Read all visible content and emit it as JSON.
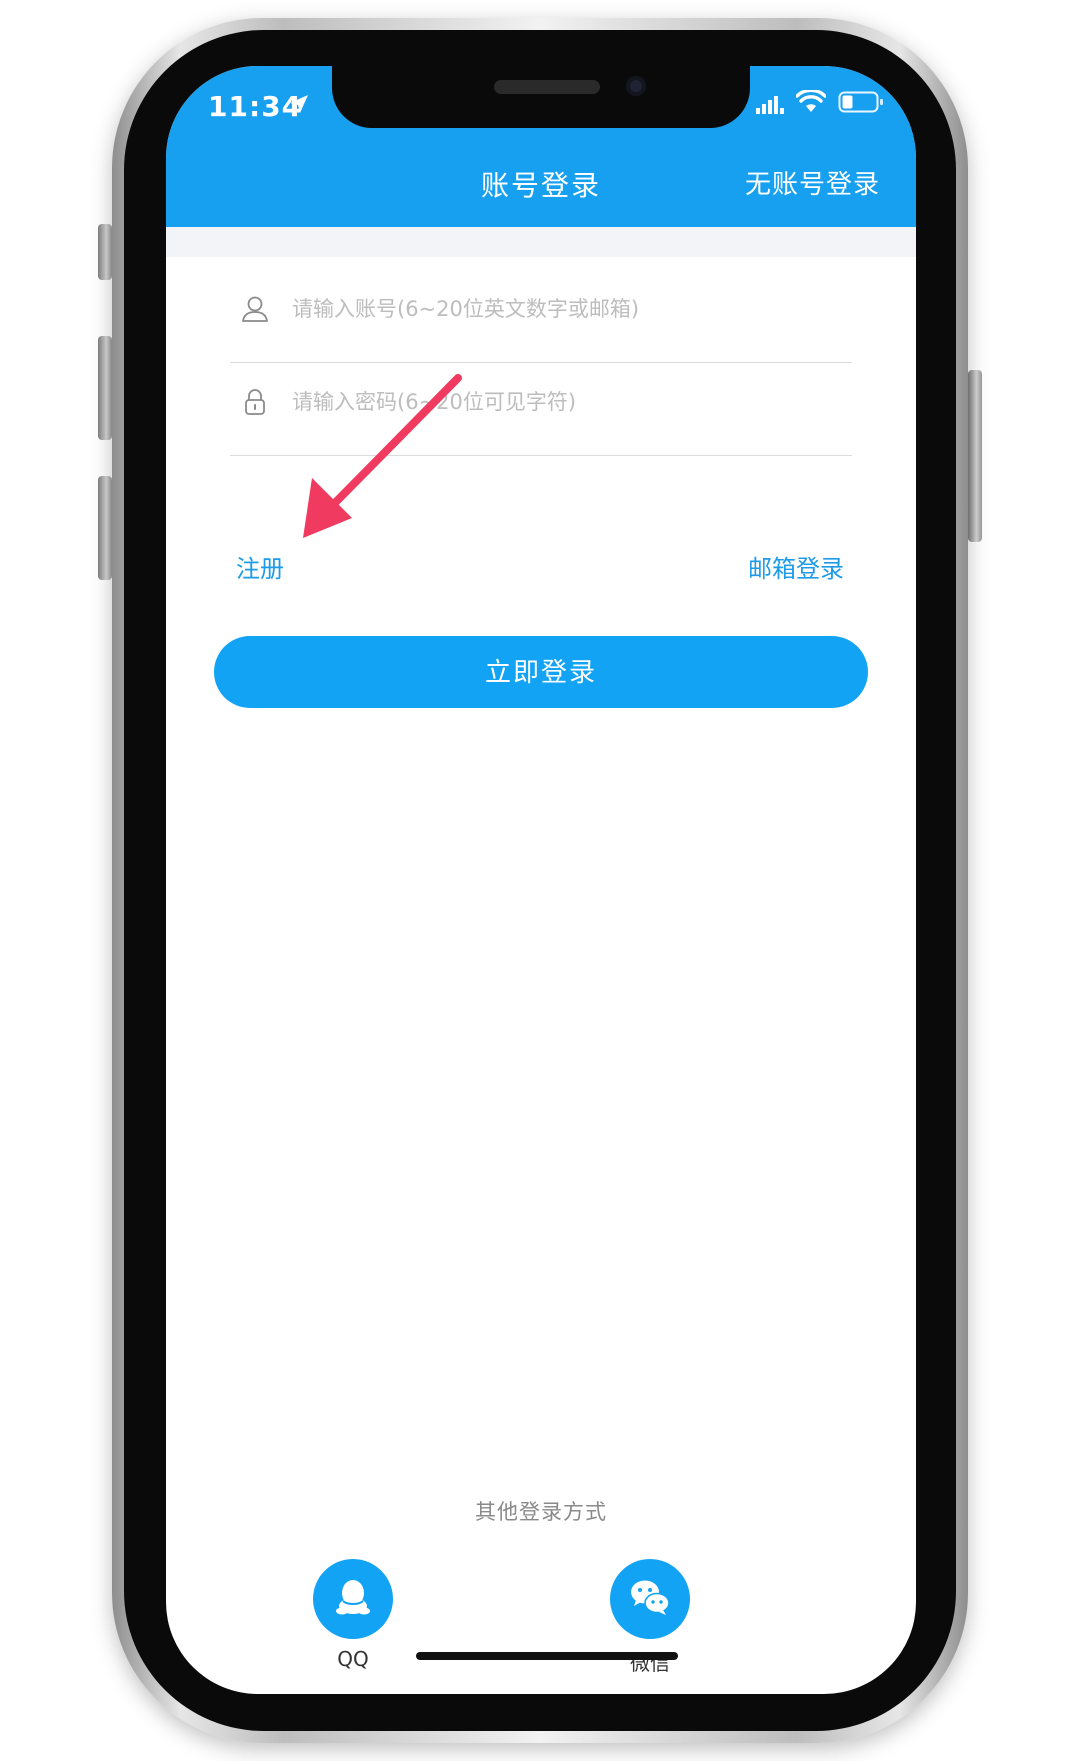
{
  "status_bar": {
    "time": "11:34"
  },
  "header": {
    "title": "账号登录",
    "right_action": "无账号登录"
  },
  "form": {
    "account_placeholder": "请输入账号(6~20位英文数字或邮箱)",
    "password_placeholder": "请输入密码(6~20位可见字符)"
  },
  "links": {
    "register": "注册",
    "email_login": "邮箱登录"
  },
  "login_button": "立即登录",
  "other_login": {
    "label": "其他登录方式",
    "options": [
      {
        "label": "QQ",
        "icon": "qq-icon"
      },
      {
        "label": "微信",
        "icon": "wechat-icon"
      }
    ]
  },
  "colors": {
    "primary": "#17a0f0",
    "link": "#1e9be8",
    "annotation_arrow": "#f03a5f"
  }
}
